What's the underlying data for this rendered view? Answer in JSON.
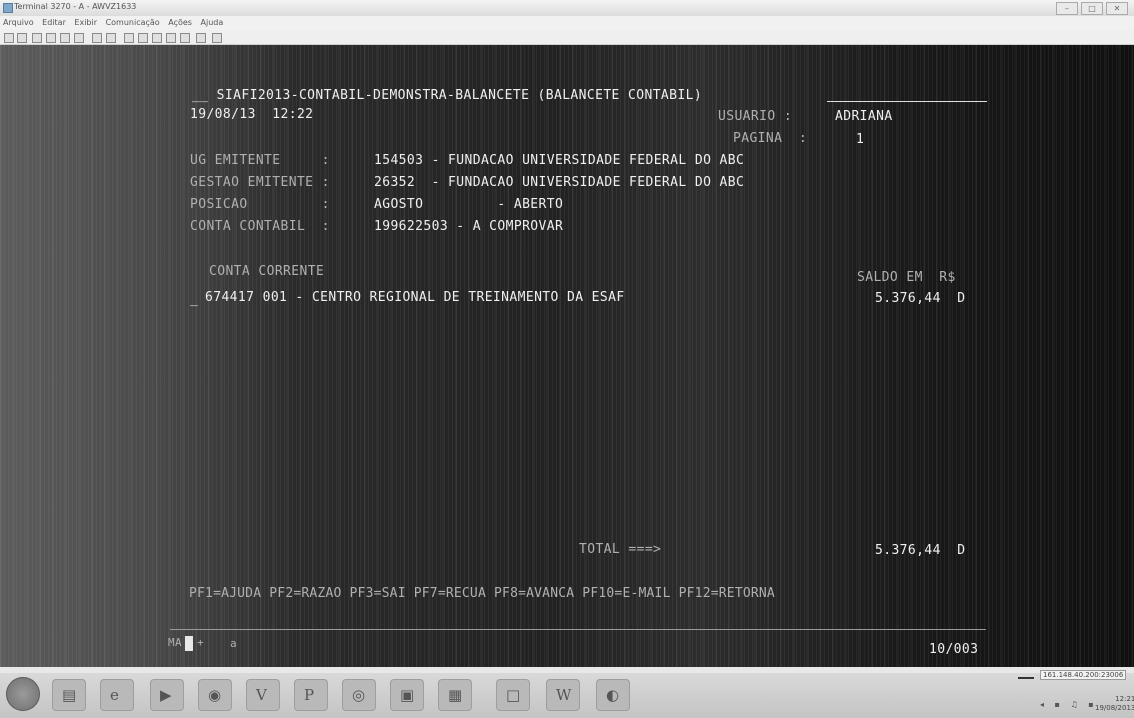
{
  "window": {
    "title": "Terminal 3270 - A - AWVZ1633"
  },
  "menu": [
    "Arquivo",
    "Editar",
    "Exibir",
    "Comunicação",
    "Ações",
    "Ajuda"
  ],
  "screen": {
    "header": "__ SIAFI2013-CONTABIL-DEMONSTRA-BALANCETE (BALANCETE CONTABIL)",
    "datetime": "19/08/13  12:22",
    "usuario_label": "USUARIO :",
    "usuario_value": "ADRIANA",
    "pagina_label": "PAGINA  :",
    "pagina_value": "1",
    "ug_label": "UG EMITENTE     :",
    "ug_value": "154503 - FUNDACAO UNIVERSIDADE FEDERAL DO ABC",
    "gestao_label": "GESTAO EMITENTE :",
    "gestao_value": "26352  - FUNDACAO UNIVERSIDADE FEDERAL DO ABC",
    "posicao_label": "POSICAO         :",
    "posicao_value": "AGOSTO         - ABERTO",
    "conta_label": "CONTA CONTABIL  :",
    "conta_value": "199622503 - A COMPROVAR",
    "col_conta_corrente": "CONTA CORRENTE",
    "col_saldo": "SALDO EM  R$",
    "rows": [
      {
        "marker": "_",
        "account": "674417 001 - CENTRO REGIONAL DE TREINAMENTO DA ESAF",
        "amount": "5.376,44  D"
      }
    ],
    "total_label": "TOTAL ===>",
    "total_value": "5.376,44  D",
    "pf_keys": "PF1=AJUDA PF2=RAZAO PF3=SAI PF7=RECUA PF8=AVANCA PF10=E-MAIL PF12=RETORNA",
    "oia_left": "MA",
    "oia_plus": "+",
    "oia_a": "a",
    "oia_position": "10/003"
  },
  "taskbar": {
    "ip": "161.148.40.200:23006",
    "clock_time": "12:21",
    "clock_date": "19/08/2013"
  }
}
